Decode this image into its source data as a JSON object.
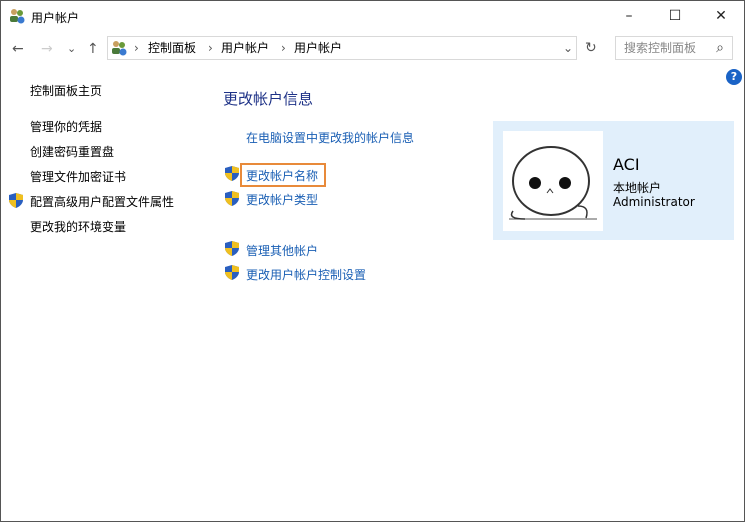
{
  "window": {
    "title": "用户帐户",
    "minimize": "–",
    "maximize": "☐",
    "close": "✕"
  },
  "nav": {
    "back": "←",
    "forward": "→",
    "recent": "⌄",
    "up": "↑"
  },
  "address": {
    "crumbs": [
      "控制面板",
      "用户帐户",
      "用户帐户"
    ],
    "separator": "›",
    "dropdown": "⌄",
    "refresh": "↻"
  },
  "search": {
    "placeholder": "搜索控制面板",
    "icon": "⌕"
  },
  "help": "?",
  "sidebar": {
    "items": [
      "控制面板主页",
      "管理你的凭据",
      "创建密码重置盘",
      "管理文件加密证书",
      "配置高级用户配置文件属性",
      "更改我的环境变量"
    ]
  },
  "main": {
    "title": "更改帐户信息",
    "links": [
      "在电脑设置中更改我的帐户信息",
      "更改帐户名称",
      "更改帐户类型",
      "管理其他帐户",
      "更改用户帐户控制设置"
    ]
  },
  "account": {
    "name": "ACI",
    "type": "本地帐户",
    "role": "Administrator"
  }
}
